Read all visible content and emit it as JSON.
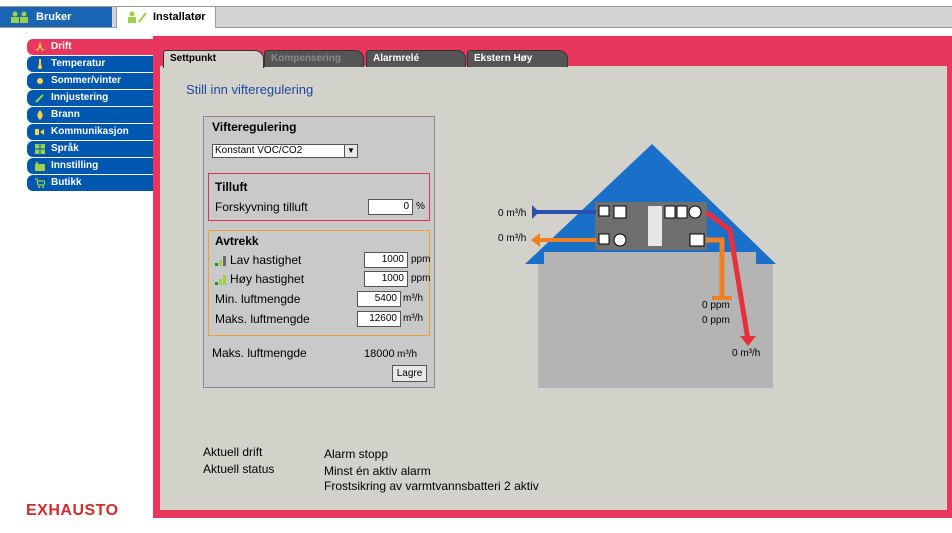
{
  "top_tabs": [
    {
      "label": "Bruker",
      "icon": "users-icon"
    },
    {
      "label": "Installatør",
      "icon": "installer-icon"
    }
  ],
  "nav": [
    {
      "label": "Drift",
      "icon": "fan-icon",
      "active": true
    },
    {
      "label": "Temperatur",
      "icon": "thermometer-icon"
    },
    {
      "label": "Sommer/vinter",
      "icon": "sun-icon"
    },
    {
      "label": "Innjustering",
      "icon": "wrench-icon"
    },
    {
      "label": "Brann",
      "icon": "fire-icon"
    },
    {
      "label": "Kommunikasjon",
      "icon": "communication-icon"
    },
    {
      "label": "Språk",
      "icon": "language-icon"
    },
    {
      "label": "Innstilling",
      "icon": "settings-icon"
    },
    {
      "label": "Butikk",
      "icon": "cart-icon"
    }
  ],
  "logo": "EXHAUSTO",
  "sub_tabs": [
    {
      "label": "Settpunkt",
      "state": "active"
    },
    {
      "label": "Kompensering",
      "state": "disabled"
    },
    {
      "label": "Alarmrelé",
      "state": "normal"
    },
    {
      "label": "Ekstern Høy",
      "state": "normal"
    }
  ],
  "heading": "Still inn vifteregulering",
  "box": {
    "title": "Vifteregulering",
    "select_value": "Konstant VOC/CO2",
    "tilluft": {
      "title": "Tilluft",
      "offset_label": "Forskyvning tilluft",
      "offset_value": "0",
      "offset_unit": "%"
    },
    "avtrekk": {
      "title": "Avtrekk",
      "low_label": "Lav hastighet",
      "low_value": "1000",
      "low_unit": "ppm",
      "high_label": "Høy hastighet",
      "high_value": "1000",
      "high_unit": "ppm",
      "min_label": "Min. luftmengde",
      "min_value": "5400",
      "min_unit": "m³/h",
      "max_label": "Maks. luftmengde",
      "max_value": "12600",
      "max_unit": "m³/h"
    },
    "maks_label": "Maks. luftmengde",
    "maks_value": "18000",
    "maks_unit": "m³/h",
    "save_label": "Lagre"
  },
  "status": {
    "drift_label": "Aktuell drift",
    "drift_value": "Alarm stopp",
    "status_label": "Aktuell status",
    "status_line1": "Minst én aktiv alarm",
    "status_line2": "Frostsikring av varmtvannsbatteri 2 aktiv"
  },
  "diagram": {
    "supply_in": "0 m³/h",
    "extract_out": "0 m³/h",
    "ppm1": "0 ppm",
    "ppm2": "0 ppm",
    "supply_out": "0 m³/h",
    "colors": {
      "supply": "#2a4fb0",
      "extract": "#f08020",
      "red": "#e8303a",
      "roof": "#1a6fc8",
      "building": "#b4b4b4"
    }
  }
}
